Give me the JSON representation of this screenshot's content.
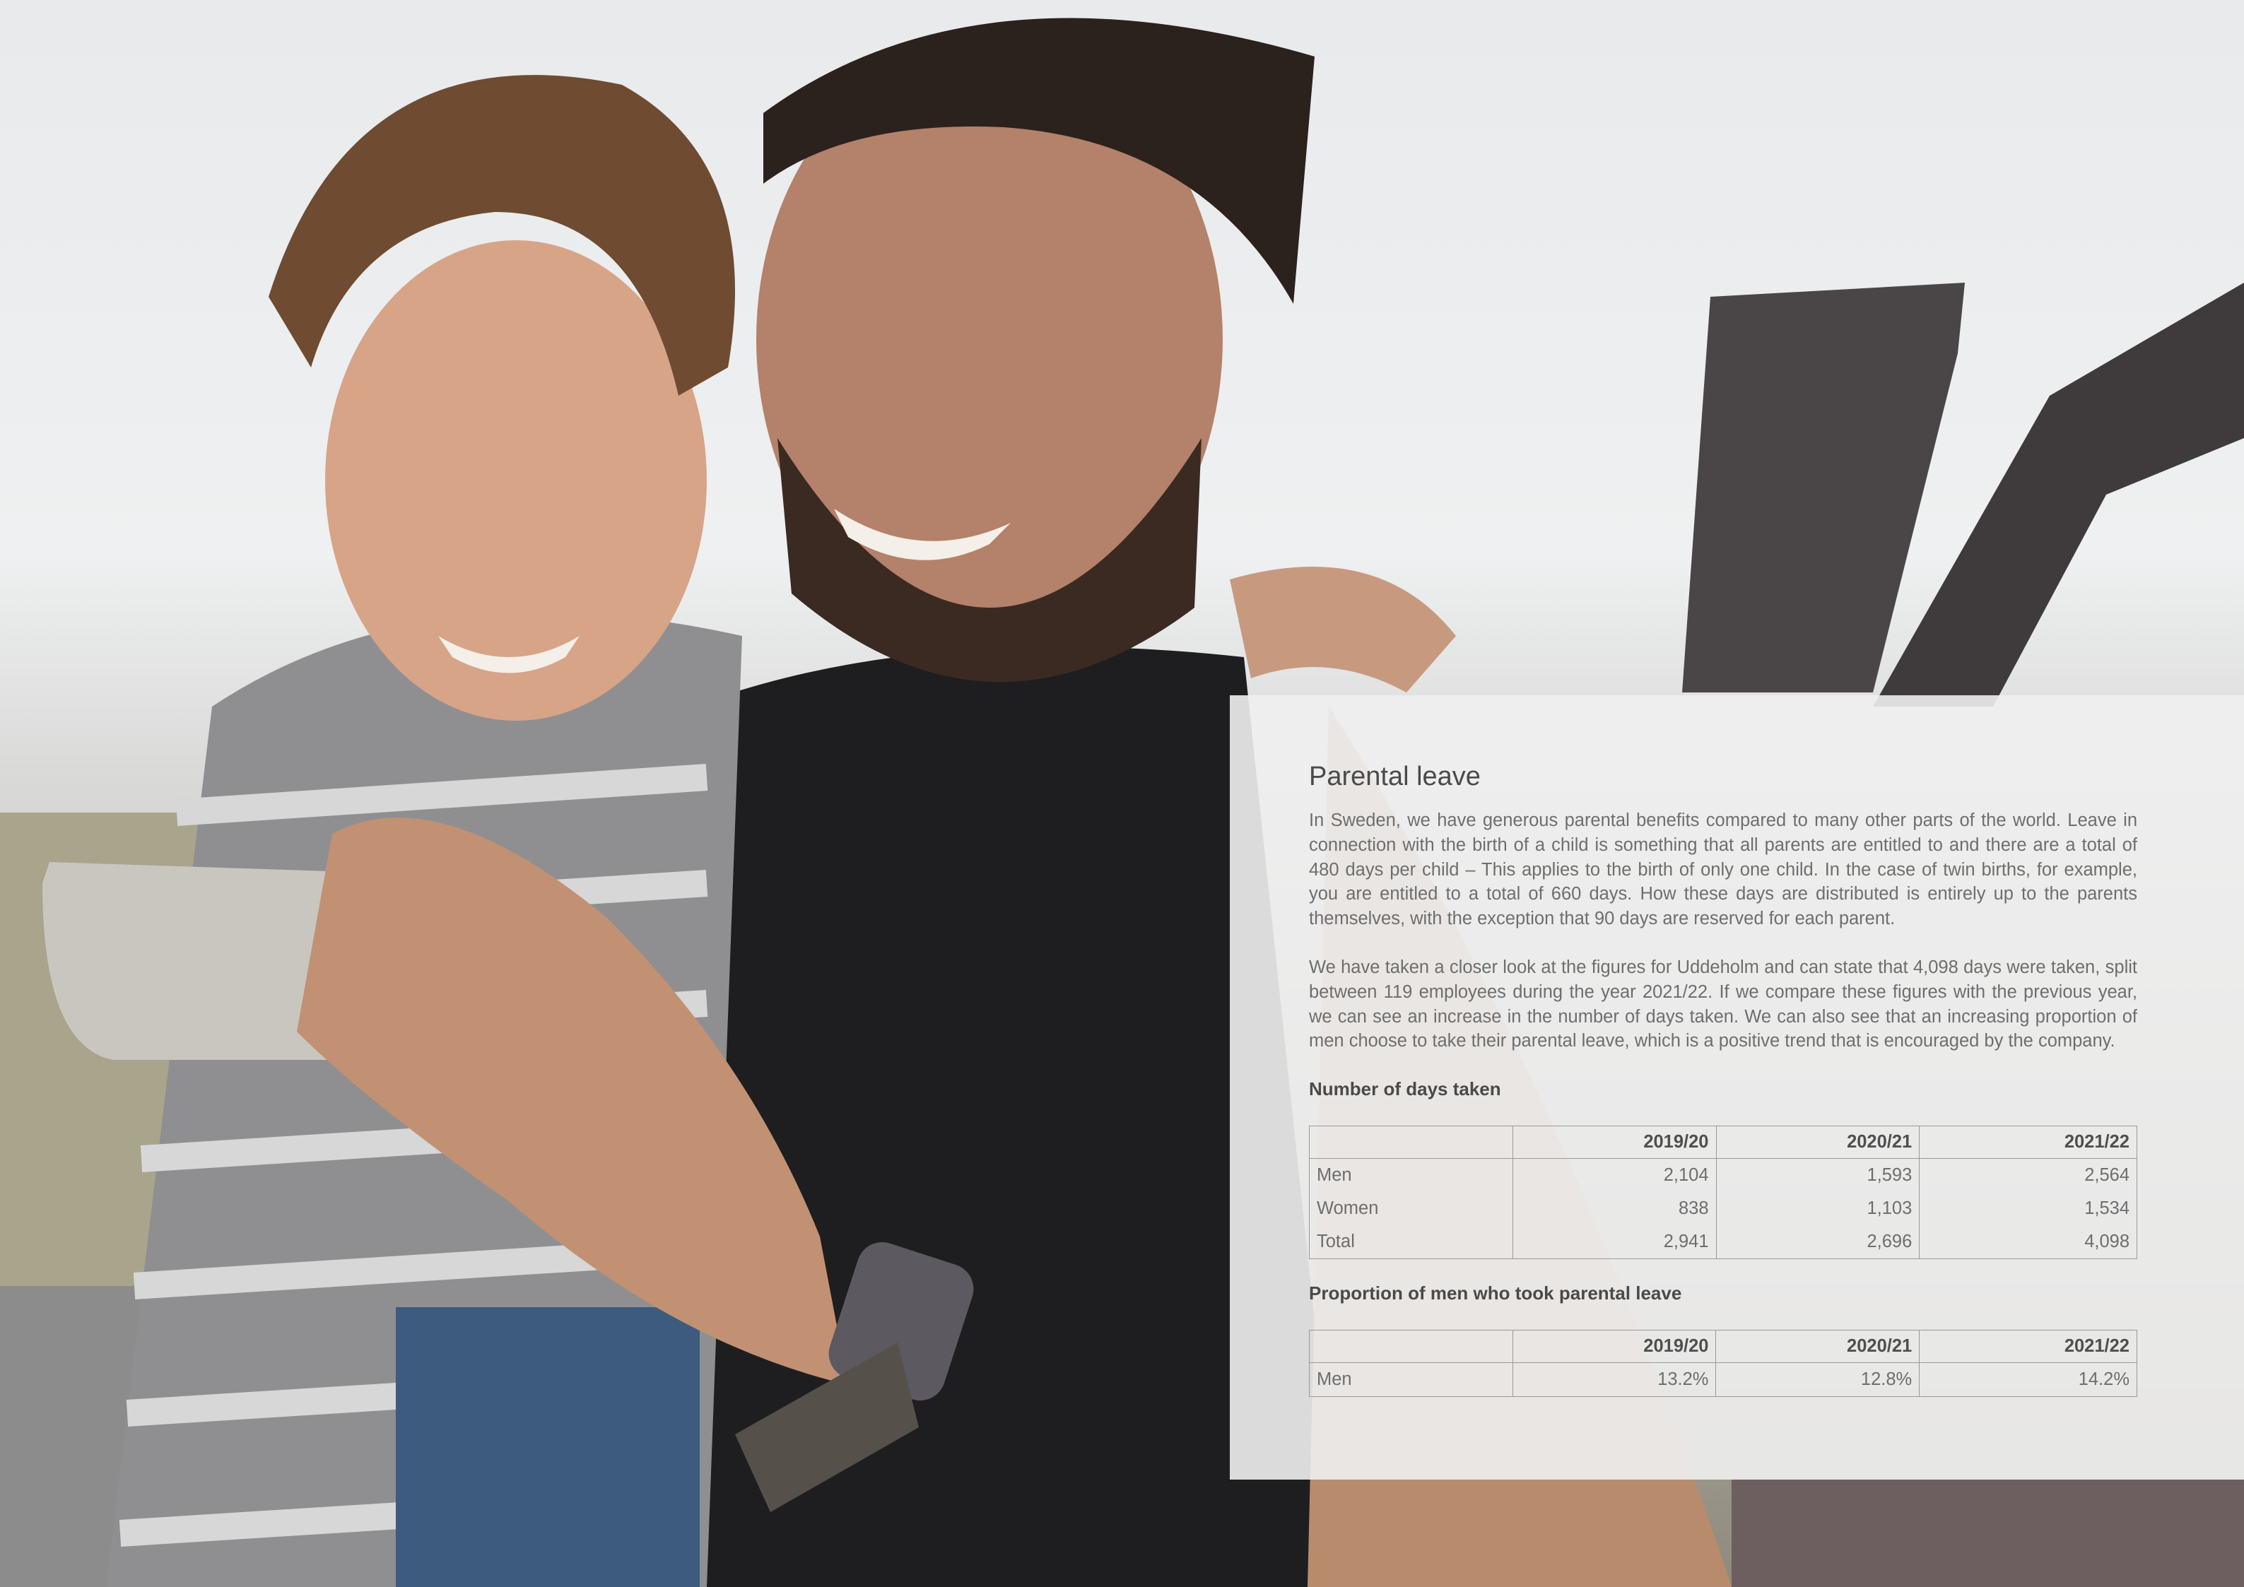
{
  "article": {
    "title": "Parental leave",
    "paragraph_1": "In Sweden, we have generous parental benefits compared to many other parts of the world. Leave in connection with the birth of a child is something that all parents are entitled to and there are a total of 480 days per child – This applies to the birth of only one child. In the case of twin births, for example, you are entitled to a total of 660 days. How these days are distributed is entirely up to the parents themselves, with the exception that 90 days are reserved for each parent.",
    "paragraph_2": "We have taken a closer look at the figures for Uddeholm and can state that 4,098 days were taken, split between 119 employees during the year 2021/22. If we compare these figures with the previous year, we can see an increase in the number of days taken. We can also see that an increasing proportion of men choose to take their parental leave, which is a positive trend that is encouraged by the company."
  },
  "days_table": {
    "heading": "Number of days taken",
    "columns": [
      "",
      "2019/20",
      "2020/21",
      "2021/22"
    ],
    "rows": [
      {
        "label": "Men",
        "values": [
          "2,104",
          "1,593",
          "2,564"
        ]
      },
      {
        "label": "Women",
        "values": [
          "838",
          "1,103",
          "1,534"
        ]
      },
      {
        "label": "Total",
        "values": [
          "2,941",
          "2,696",
          "4,098"
        ]
      }
    ]
  },
  "proportion_table": {
    "heading": "Proportion of men who took parental leave",
    "columns": [
      "",
      "2019/20",
      "2020/21",
      "2021/22"
    ],
    "rows": [
      {
        "label": "Men",
        "values": [
          "13.2%",
          "12.8%",
          "14.2%"
        ]
      }
    ]
  },
  "colors": {
    "panel_background": "#f0f0f0",
    "text": "#6e6e6e",
    "heading_text": "#4a4a4a",
    "table_border": "#9a9a9a"
  },
  "image": {
    "subject": "father and son smiling at a smartphone outdoors"
  }
}
